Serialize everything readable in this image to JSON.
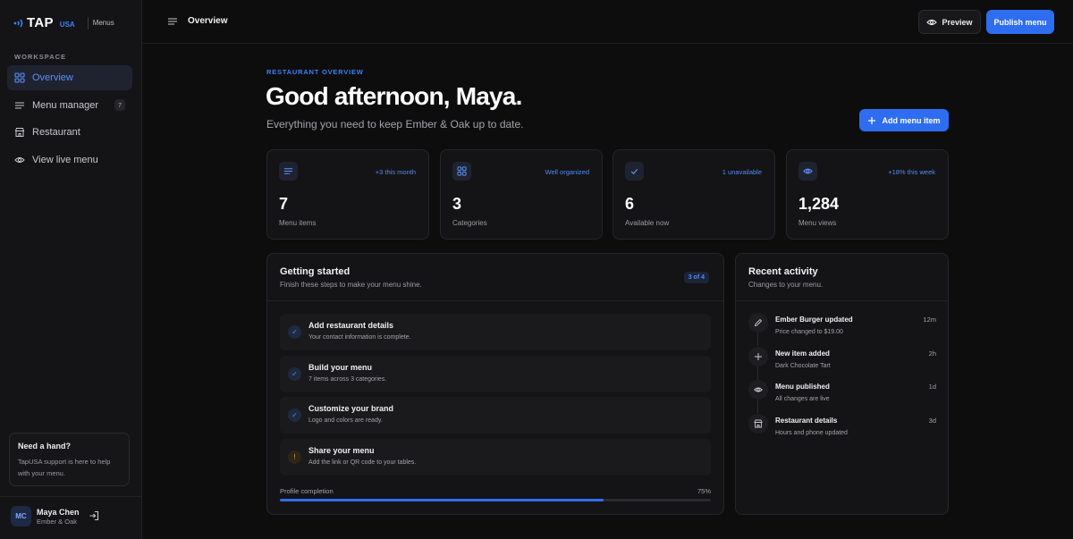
{
  "brand": {
    "name": "TAP",
    "suffix": "USA",
    "section": "Menus"
  },
  "sidebar": {
    "section_label": "WORKSPACE",
    "items": [
      {
        "label": "Overview",
        "icon": "grid-icon",
        "active": true
      },
      {
        "label": "Menu manager",
        "icon": "list-icon",
        "badge": "7"
      },
      {
        "label": "Restaurant",
        "icon": "storefront-icon"
      },
      {
        "label": "View live menu",
        "icon": "eye-icon"
      }
    ],
    "help": {
      "title": "Need a hand?",
      "text": "TapUSA support is here to help with your menu."
    },
    "user": {
      "initials": "MC",
      "name": "Maya Chen",
      "restaurant": "Ember & Oak"
    }
  },
  "topbar": {
    "title": "Overview",
    "preview_label": "Preview",
    "publish_label": "Publish menu"
  },
  "hero": {
    "eyebrow": "RESTAURANT OVERVIEW",
    "greeting": "Good afternoon, Maya.",
    "subtitle": "Everything you need to keep Ember & Oak up to date.",
    "add_label": "Add menu item"
  },
  "stats": [
    {
      "icon": "list-icon",
      "meta": "+3 this month",
      "value": "7",
      "label": "Menu items"
    },
    {
      "icon": "grid-icon",
      "meta": "Well organized",
      "value": "3",
      "label": "Categories"
    },
    {
      "icon": "check-icon",
      "meta": "1 unavailable",
      "value": "6",
      "label": "Available now"
    },
    {
      "icon": "eye-icon",
      "meta": "+18% this week",
      "value": "1,284",
      "label": "Menu views"
    }
  ],
  "getting_started": {
    "title": "Getting started",
    "subtitle": "Finish these steps to make your menu shine.",
    "badge": "3 of 4",
    "steps": [
      {
        "title": "Add restaurant details",
        "desc": "Your contact information is complete.",
        "status": "done",
        "mark": "✓"
      },
      {
        "title": "Build your menu",
        "desc": "7 items across 3 categories.",
        "status": "done",
        "mark": "✓"
      },
      {
        "title": "Customize your brand",
        "desc": "Logo and colors are ready.",
        "status": "done",
        "mark": "✓"
      },
      {
        "title": "Share your menu",
        "desc": "Add the link or QR code to your tables.",
        "status": "pending",
        "mark": "!"
      }
    ],
    "progress_label": "Profile completion",
    "progress_text": "75%",
    "progress": 0.75
  },
  "activity": {
    "title": "Recent activity",
    "subtitle": "Changes to your menu.",
    "items": [
      {
        "icon": "pencil-icon",
        "title": "Ember Burger updated",
        "desc": "Price changed to $19.00",
        "time": "12m"
      },
      {
        "icon": "plus-icon",
        "title": "New item added",
        "desc": "Dark Chocolate Tart",
        "time": "2h"
      },
      {
        "icon": "eye-icon",
        "title": "Menu published",
        "desc": "All changes are live",
        "time": "1d"
      },
      {
        "icon": "storefront-icon",
        "title": "Restaurant details",
        "desc": "Hours and phone updated",
        "time": "3d"
      }
    ]
  },
  "colors": {
    "accent": "#2f6df0",
    "accent_text": "#4f8bf7",
    "background": "#0d0d0e",
    "panel": "#141416",
    "warning": "#e4a530"
  }
}
